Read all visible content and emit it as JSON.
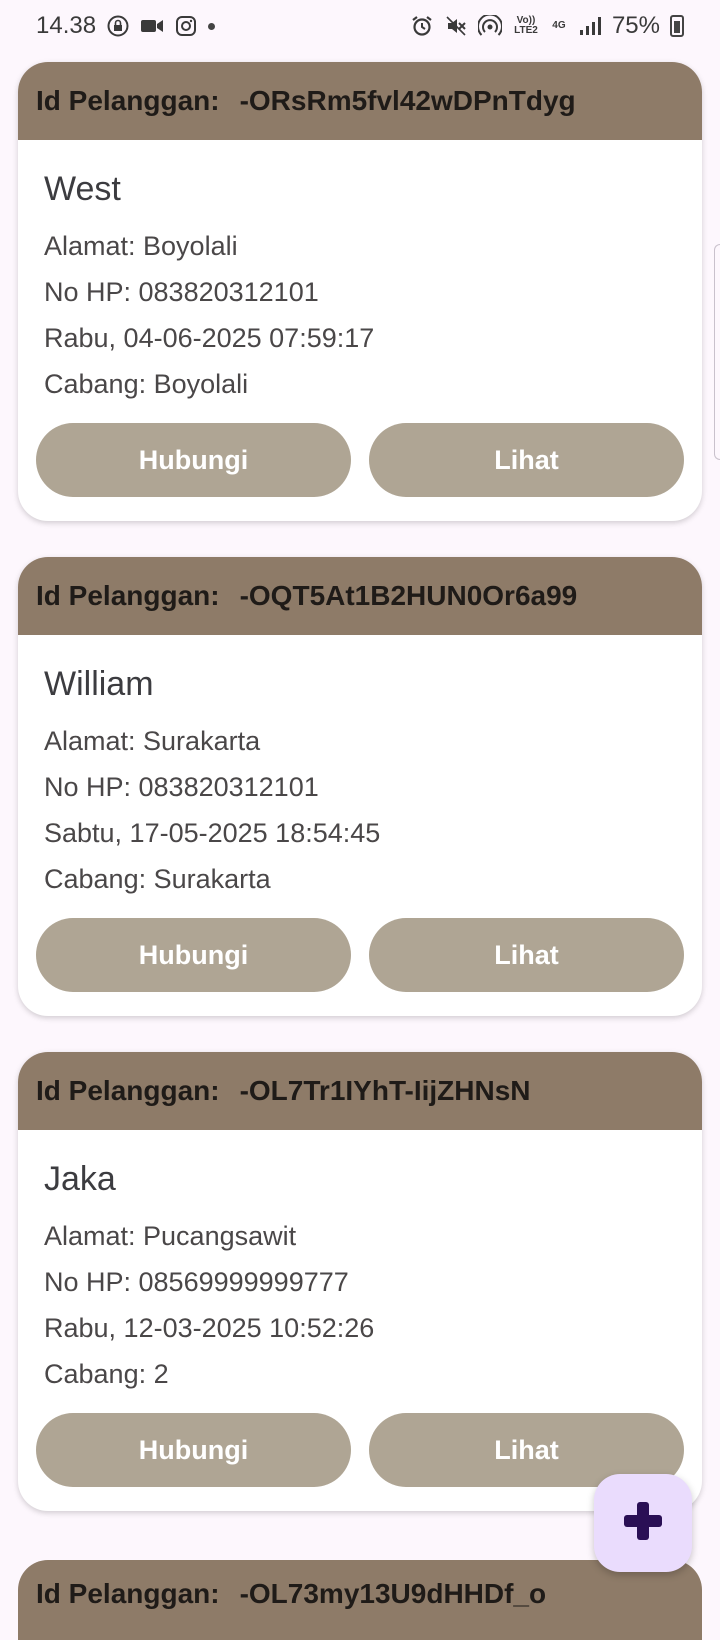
{
  "status_bar": {
    "time": "14.38",
    "network_tiny_1": "Vo)) LTE2",
    "network_tiny_2": "4G",
    "battery": "75%"
  },
  "id_label": "Id Pelanggan:",
  "buttons": {
    "contact": "Hubungi",
    "view": "Lihat"
  },
  "customers": [
    {
      "id": "-ORsRm5fvl42wDPnTdyg",
      "name": "West",
      "address": "Alamat: Boyolali",
      "phone": "No HP: 083820312101",
      "datetime": "Rabu, 04-06-2025 07:59:17",
      "branch": "Cabang: Boyolali"
    },
    {
      "id": "-OQT5At1B2HUN0Or6a99",
      "name": "William",
      "address": "Alamat: Surakarta",
      "phone": "No HP: 083820312101",
      "datetime": "Sabtu, 17-05-2025 18:54:45",
      "branch": "Cabang: Surakarta"
    },
    {
      "id": "-OL7Tr1IYhT-IijZHNsN",
      "name": "Jaka",
      "address": "Alamat: Pucangsawit",
      "phone": "No HP: 08569999999777",
      "datetime": "Rabu, 12-03-2025 10:52:26",
      "branch": "Cabang: 2"
    }
  ],
  "partial_card": {
    "label": "Id Pelanggan:",
    "id": "-OL73my13U9dHHDf_o"
  },
  "colors": {
    "header": "#8e7b68",
    "button": "#afa594",
    "fab": "#eadcfd",
    "fab_icon": "#2a0f55",
    "background": "#fdf7fd"
  },
  "icons": {
    "fab": "plus-icon"
  }
}
